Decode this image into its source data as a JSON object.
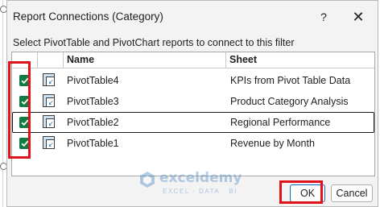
{
  "dialog": {
    "title": "Report Connections (Category)",
    "help_label": "?",
    "close_label": "✕",
    "instruction": "Select PivotTable and PivotChart reports to connect to this filter"
  },
  "table": {
    "columns": [
      "",
      "",
      "Name",
      "Sheet"
    ],
    "rows": [
      {
        "checked": true,
        "name": "PivotTable4",
        "sheet": "KPIs from Pivot Table Data"
      },
      {
        "checked": true,
        "name": "PivotTable3",
        "sheet": "Product Category Analysis"
      },
      {
        "checked": true,
        "name": "PivotTable2",
        "sheet": "Regional Performance"
      },
      {
        "checked": true,
        "name": "PivotTable1",
        "sheet": "Revenue by Month"
      }
    ],
    "selected_row": 2,
    "row_icon": "pivot-table-icon"
  },
  "buttons": {
    "ok": "OK",
    "cancel": "Cancel"
  },
  "watermark": {
    "name": "exceldemy",
    "tagline": "EXCEL · DATA · BI"
  },
  "colors": {
    "checkbox": "#107c41",
    "highlight": "#e0121b",
    "ok_border": "#0f6cbd"
  }
}
